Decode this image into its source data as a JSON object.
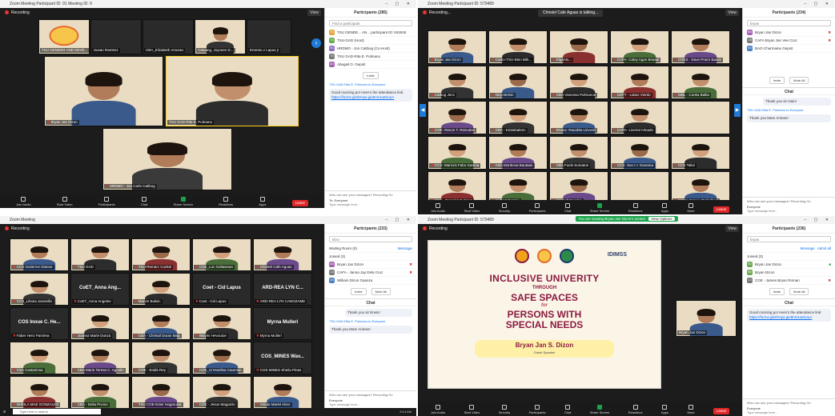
{
  "q1": {
    "title": "Zoom Meeting Participant ID: 91 Meeting ID: 9",
    "recording": "Recording",
    "view": "View",
    "strip": [
      {
        "name": "TSU GENDER AND DEVE..."
      },
      {
        "name": "Susan Ramirez"
      },
      {
        "name": "CBA_Elizabeth Amurao"
      },
      {
        "name": "Catuang, Joyceen D..."
      },
      {
        "name": "Ernesto z Lapus jr"
      }
    ],
    "tiles": [
      {
        "name": "Bryan Jan Dizon"
      },
      {
        "name": "TSU GAD-Rita E. Pulmano"
      },
      {
        "name": "HRDMO - Jon Carlo Catibog"
      }
    ],
    "toolbar": [
      "Join Audio",
      "Start Video",
      "Participants",
      "Chat",
      "Share Screen",
      "Reactions",
      "Apps"
    ],
    "participants_count": "285",
    "leave": "Leave",
    "panel": {
      "title": "Participants (285)",
      "search": "Find a participant",
      "rows": [
        {
          "initials": "TG",
          "color": "#e8a23a",
          "name": "TSU GENDE... AN... participant ID: 915045"
        },
        {
          "initials": "TG",
          "color": "#6aa84f",
          "name": "TSU-GAD (Host)"
        },
        {
          "initials": "HC",
          "color": "#8e6bc4",
          "name": "HRDMO - Jon Catibog (Co-Host)"
        },
        {
          "initials": "TG",
          "color": "#777777",
          "name": "TSU GAD-Rita E. Pulmano"
        },
        {
          "initials": "AO",
          "color": "#a55fb0",
          "name": "Abegail O. Gepsit"
        }
      ],
      "invite": "Invite",
      "chat_intro": "TSU GAD-Rita E. Pulmano to Everyone",
      "chat_msg": "Good morning po! Here's the attendance link:",
      "chat_link": "https://forms.gle/DHya gie8nm1wNUuA",
      "who_see": "Who can see your messages? Recording On",
      "to_label": "To:",
      "to_value": "Everyone",
      "type_placeholder": "Type message here..."
    }
  },
  "q2": {
    "title": "Zoom Meeting Participant ID: 579489",
    "recording": "Recording...",
    "speaking": "Christel Cafe Aguas is talking...",
    "view": "View",
    "grid": [
      "Bryan Jan Dizon",
      "Catbo-TSU-Blen Bitk...",
      "ElgaAlo...",
      "CAFA- Caloy Agan Briasal",
      "COES - Dave Praire Bautis",
      "Catbog Jenc",
      "Dicp-Belvin",
      "CBA-Vanessa Pulmanoe",
      "CEFT - Liatus Vierdo",
      "SIBL - Cunka Baltia",
      "COE- Rexon T. Rescalon",
      "CBA - Kristebalenc",
      "Dnanx: Rauobta Linvvoh",
      "CAPA- Liverial Almado",
      "",
      "CCS- Maricris Fabo Ganma",
      "CBA Mordecai Bautaan",
      "CBA Fuels Sumaton",
      "CCS- Sun n r Ganama",
      "CCS Tallal",
      "CCS - Bernakit Gutirrez",
      "Cidbert Bertolo",
      "Mitchell Bendon",
      "",
      "CSMA Esmee Tagbalbag"
    ],
    "participants_count": "234",
    "toolbar": [
      "Join Audio",
      "Start Video",
      "Security",
      "Participants",
      "Chat",
      "Share Screen",
      "Reactions",
      "Apps",
      "More"
    ],
    "leave": "Leave",
    "panel": {
      "title": "Participants (234)",
      "search": "bryan",
      "rows": [
        {
          "initials": "BN",
          "color": "#a55fb0",
          "name": "Bryan Jan Dizon"
        },
        {
          "initials": "CB",
          "color": "#777777",
          "name": "CAFA Bryan Jan Vee Cruz"
        },
        {
          "initials": "VG",
          "color": "#4a7fc4",
          "name": "BAO-Charmaine Gepsit"
        }
      ],
      "invite": "Invite",
      "share_all": "Mute All",
      "chat_msg1": "Thank you sir Irwin!",
      "chat_intro": "TSU GAD-Rita E. Pulmano to Everyone",
      "chat_msg2": "Thank you Mam Arimee!",
      "who_see": "Who can see your messages? Recording On",
      "to_value": "Everyone",
      "type_placeholder": "Type message here..."
    }
  },
  "q3": {
    "title": "Zoom Meeting",
    "recording": "Recording",
    "grid": [
      "CCS Gutierrez Dianne",
      "TSU GAD",
      "TSU-Remarc Cunkel",
      "COE_Luc Gultawnan",
      "Christel Cafe Aguas",
      "CCS_Liliana Jaramillo",
      "CoET_Anna Angeles",
      "Marvin Bulisic",
      "Coet - Cid Lapus",
      "ARD-REA LYN CANOZAME",
      "Faber Hero Pamirea",
      "Joanna Marie Dunza",
      "CBA - Christal Duran Mag",
      "Waymi Hevoutoe",
      "Myrna Mulleri",
      "CSA Castaninsa",
      "CBA Marie Teresa C. Agustin",
      "COE - Eralis Rey",
      "COE_CrVeatilisa Caumisn",
      "COS MINES Sheila Pinas",
      "SHEILA MAE GONZALES",
      "CBA - Delia Pivoso",
      "TSU COE-Ester Hagaruisa",
      "COE - Jesus Magaizto",
      "Vsnda Mariel Aloro"
    ],
    "big_labels": {
      "t6": "CoET_Anna Ang...",
      "t8": "Coet - Cid Lapus",
      "t9": "ARD-REA LYN C...",
      "t10": "COS Inoue C. He...",
      "t14": "Myrna Mulleri",
      "t19": "COS_MINES Wav..."
    },
    "taskbar_search": "Type here to search",
    "panel": {
      "title": "Participants (233)",
      "search": "Dizo",
      "waiting": "Waiting Room (0)",
      "message": "Message",
      "joined": "Joined (3)",
      "rows": [
        {
          "initials": "AN",
          "color": "#a55fb0",
          "name": "Bryan Jan Dizon"
        },
        {
          "initials": "CA",
          "color": "#777777",
          "name": "CAFA - Janna Jay Dela Cruz"
        },
        {
          "initials": "VG",
          "color": "#4a7fc4",
          "name": "William Dizon Gaanza"
        }
      ],
      "invite": "Invite",
      "mute_all": "Mute All",
      "chat_msg1": "Thank you sir Erwin!",
      "chat_intro": "TSU GAD-Rita E. Pulmano to Everyone",
      "chat_msg2": "Thank you Mam Arimee!",
      "who_see": "Who can see your messages? Recording On",
      "to_value": "Everyone",
      "type_placeholder": "Type message here...",
      "clock": "9:14 AM"
    }
  },
  "q4": {
    "title": "Zoom Meeting Participant ID: 579489",
    "recording": "Recording",
    "notice": "You are viewing Bryan Jan Dizon's screen",
    "view_options": "View Options",
    "view": "View",
    "slide": {
      "idimss": "IDIMSS",
      "line1": "INCLUSIVE UNIVERITY",
      "line2": "THROUGH",
      "line3": "SAFE SPACES",
      "line4": "for",
      "line5": "PERSONS WITH",
      "line6": "SPECIAL NEEDS",
      "speaker": "Bryan Jan S. Dizon",
      "speaker_role": "Guest Speaker"
    },
    "cam_name": "Bryan Jan Dizon",
    "participants_count": "241",
    "toolbar": [
      "Join Audio",
      "Start Video",
      "Security",
      "Participants",
      "Chat",
      "Share Screen",
      "Reactions",
      "Apps",
      "More"
    ],
    "leave": "Leave",
    "panel": {
      "title": "Participants (236)",
      "search": "bryan",
      "message": "Message",
      "admit": "Admit all",
      "joined": "Joined (3)",
      "rows": [
        {
          "initials": "BJ",
          "color": "#6aa84f",
          "name": "Bryan Jan Dizon"
        },
        {
          "initials": "BD",
          "color": "#6aa84f",
          "name": "Bryan Dizon"
        },
        {
          "initials": "CJ",
          "color": "#777777",
          "name": "COE - James Bryan Roman"
        }
      ],
      "invite": "Invite",
      "mute_all": "Mute All",
      "chat_msg": "Good morning po! Here's the attendance link:",
      "chat_link": "https://forms.gle/DHya gie8nm1wNUuA",
      "who_see": "Who can see your messages? Recording On",
      "to_value": "Everyone",
      "type_placeholder": "Type message here..."
    }
  }
}
